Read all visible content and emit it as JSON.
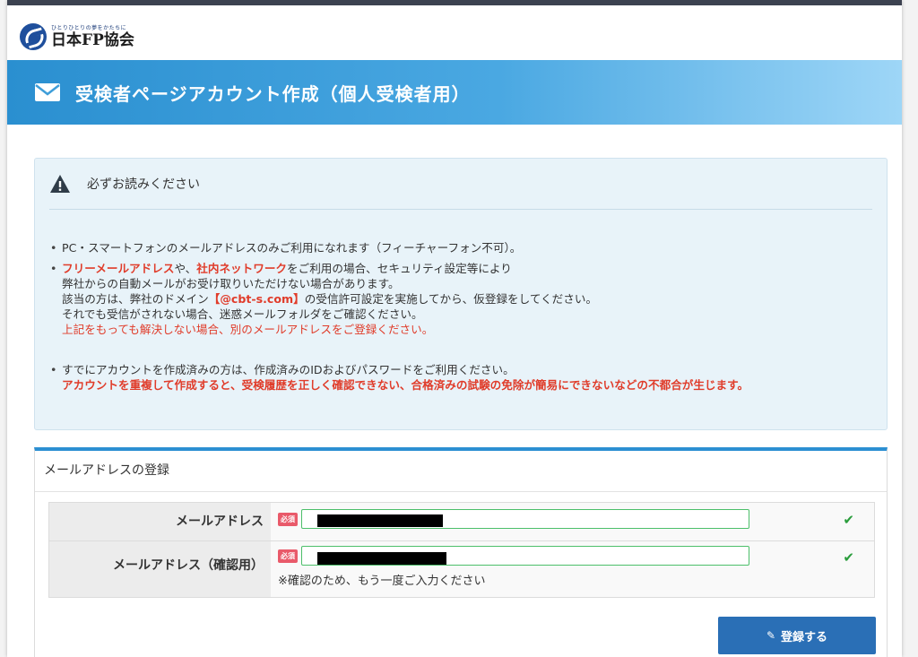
{
  "header": {
    "logo_tagline": "ひとりひとりの夢をかたちに",
    "logo_name": "日本FP協会",
    "banner_icon": "envelope-icon",
    "banner_title": "受検者ページアカウント作成（個人受検者用）"
  },
  "notice": {
    "icon": "warning-icon",
    "title": "必ずお読みください",
    "item1": "PC・スマートフォンのメールアドレスのみご利用になれます（フィーチャーフォン不可）。",
    "item2": {
      "part1_red": "フリーメールアドレス",
      "part2": "や、",
      "part3_red": "社内ネットワーク",
      "part4": "をご利用の場合、セキュリティ設定等により",
      "line2": "弊社からの自動メールがお受け取りいただけない場合があります。",
      "line3_pre": "該当の方は、弊社のドメイン",
      "line3_red": "【@cbt-s.com】",
      "line3_post": "の受信許可設定を実施してから、仮登録をしてください。",
      "line4": "それでも受信がされない場合、迷惑メールフォルダをご確認ください。",
      "line5_red": "上記をもっても解決しない場合、別のメールアドレスをご登録ください。"
    },
    "item3": {
      "line1": "すでにアカウントを作成済みの方は、作成済みのIDおよびパスワードをご利用ください。",
      "line2_red": "アカウントを重複して作成すると、受検履歴を正しく確認できない、合格済みの試験の免除が簡易にできないなどの不都合が生じます。"
    }
  },
  "registration": {
    "title": "メールアドレスの登録",
    "email_label": "メールアドレス",
    "confirm_label": "メールアドレス（確認用）",
    "required_badge": "必須",
    "confirm_hint": "※確認のため、もう一度ご入力ください",
    "check_icon": "checkmark-icon",
    "submit_label": "登録する",
    "submit_icon": "edit-icon"
  }
}
